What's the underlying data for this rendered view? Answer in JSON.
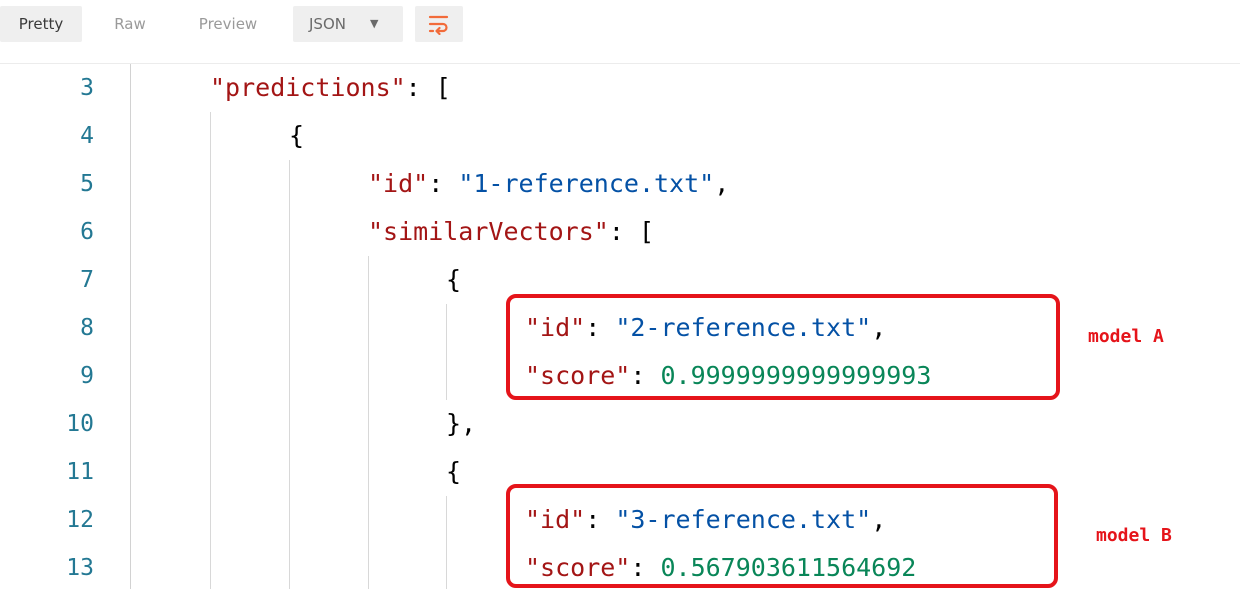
{
  "toolbar": {
    "tabs": [
      {
        "label": "Pretty",
        "active": true
      },
      {
        "label": "Raw",
        "active": false
      },
      {
        "label": "Preview",
        "active": false
      }
    ],
    "format_select": {
      "value": "JSON"
    },
    "wrap_icon": "wrap-lines-icon"
  },
  "editor": {
    "lines": [
      {
        "num": "3",
        "key": "\"predictions\"",
        "sep": ": ",
        "val": "[",
        "val_type": "punc"
      },
      {
        "num": "4",
        "key": "",
        "sep": "",
        "val": "{",
        "val_type": "punc"
      },
      {
        "num": "5",
        "key": "\"id\"",
        "sep": ": ",
        "val": "\"1-reference.txt\"",
        "val_type": "str",
        "tail": ","
      },
      {
        "num": "6",
        "key": "\"similarVectors\"",
        "sep": ": ",
        "val": "[",
        "val_type": "punc"
      },
      {
        "num": "7",
        "key": "",
        "sep": "",
        "val": "{",
        "val_type": "punc"
      },
      {
        "num": "8",
        "key": "\"id\"",
        "sep": ": ",
        "val": "\"2-reference.txt\"",
        "val_type": "str",
        "tail": ","
      },
      {
        "num": "9",
        "key": "\"score\"",
        "sep": ": ",
        "val": "0.9999999999999993",
        "val_type": "num"
      },
      {
        "num": "10",
        "key": "",
        "sep": "",
        "val": "},",
        "val_type": "punc"
      },
      {
        "num": "11",
        "key": "",
        "sep": "",
        "val": "{",
        "val_type": "punc"
      },
      {
        "num": "12",
        "key": "\"id\"",
        "sep": ": ",
        "val": "\"3-reference.txt\"",
        "val_type": "str",
        "tail": ","
      },
      {
        "num": "13",
        "key": "\"score\"",
        "sep": ": ",
        "val": "0.567903611564692",
        "val_type": "num"
      }
    ]
  },
  "annotations": [
    {
      "label": "model A"
    },
    {
      "label": "model B"
    }
  ],
  "colors": {
    "key": "#a31515",
    "string": "#0451a5",
    "number": "#098658",
    "line_number": "#237893",
    "annotation": "#e5141a",
    "accent": "#f26b3a"
  }
}
